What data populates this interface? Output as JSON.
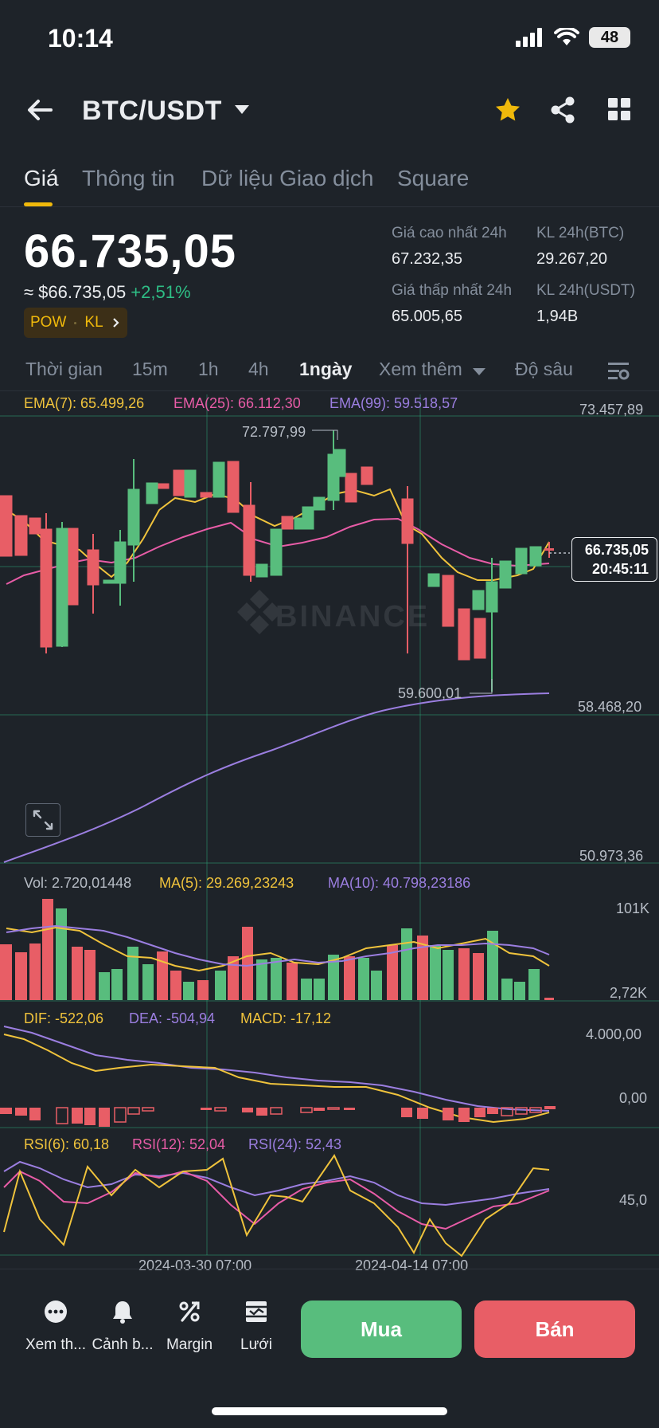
{
  "status": {
    "time": "10:14",
    "battery": "48"
  },
  "header": {
    "pair": "BTC/USDT"
  },
  "tabs": [
    {
      "label": "Giá"
    },
    {
      "label": "Thông tin"
    },
    {
      "label": "Dữ liệu Giao dịch"
    },
    {
      "label": "Square"
    }
  ],
  "ticker": {
    "price": "66.735,05",
    "price_usd": "≈ $66.735,05",
    "change": "+2,51%",
    "badge_a": "POW",
    "badge_b": "KL",
    "high_label": "Giá cao nhất 24h",
    "high_value": "67.232,35",
    "low_label": "Giá thấp nhất 24h",
    "low_value": "65.005,65",
    "vol_btc_label": "KL 24h(BTC)",
    "vol_btc_value": "29.267,20",
    "vol_usdt_label": "KL 24h(USDT)",
    "vol_usdt_value": "1,94B"
  },
  "intervals": [
    {
      "label": "Thời gian"
    },
    {
      "label": "15m"
    },
    {
      "label": "1h"
    },
    {
      "label": "4h"
    },
    {
      "label": "1ngày"
    },
    {
      "label": "Xem thêm"
    },
    {
      "label": "Độ sâu"
    }
  ],
  "main_chart": {
    "ema7": "EMA(7): 65.499,26",
    "ema25": "EMA(25): 66.112,30",
    "ema99": "EMA(99): 59.518,57",
    "axis_top": "73.457,89",
    "axis_mid": "58.468,20",
    "axis_bot": "50.973,36",
    "high_mark": "72.797,99",
    "low_mark": "59.600,01",
    "last_price": "66.735,05",
    "countdown": "20:45:11",
    "watermark": "BINANCE"
  },
  "volume": {
    "vol": "Vol: 2.720,01448",
    "ma5": "MA(5): 29.269,23243",
    "ma10": "MA(10): 40.798,23186",
    "axis_top": "101K",
    "axis_bot": "2,72K"
  },
  "macd": {
    "dif": "DIF: -522,06",
    "dea": "DEA: -504,94",
    "macd": "MACD: -17,12",
    "axis_top": "4.000,00",
    "axis_mid": "0,00"
  },
  "rsi": {
    "rsi6": "RSI(6): 60,18",
    "rsi12": "RSI(12): 52,04",
    "rsi24": "RSI(24): 52,43",
    "axis_mid": "45,0"
  },
  "x_axis": {
    "date1": "2024-03-30 07:00",
    "date2": "2024-04-14 07:00"
  },
  "bottom_bar": {
    "more": "Xem th...",
    "alert": "Cảnh b...",
    "margin": "Margin",
    "grid": "Lưới",
    "buy": "Mua",
    "sell": "Bán"
  },
  "colors": {
    "up": "#58bd7d",
    "down": "#e85e66",
    "accent": "#f0b90b",
    "ema7": "#f0c33c",
    "ema25": "#e85ca7",
    "ema99": "#9b7ee0"
  }
}
